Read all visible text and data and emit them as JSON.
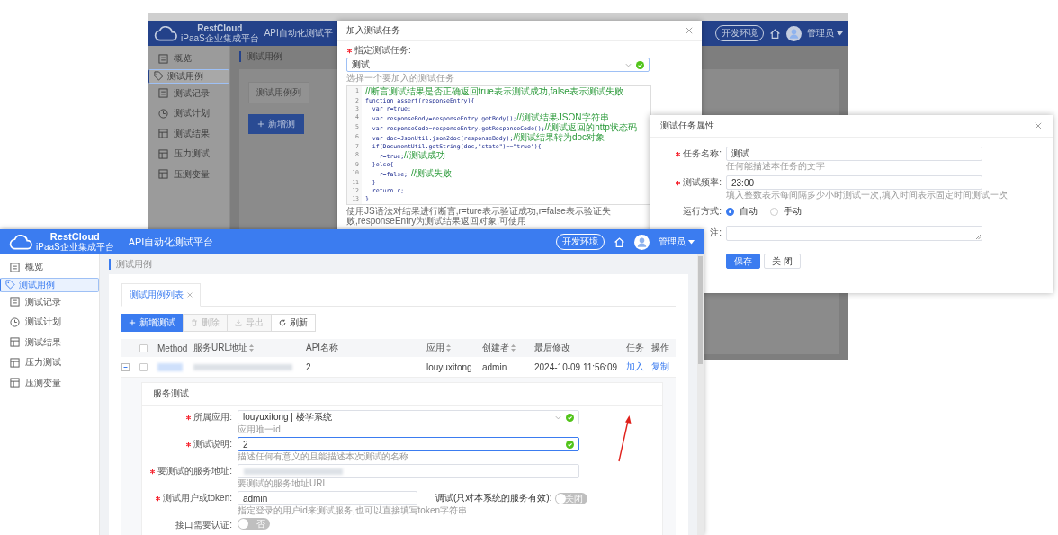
{
  "back_window": {
    "header": {
      "brand": "RestCloud",
      "brand_subtitle": "iPaaS企业集成平台",
      "app_title": "API自动化测试平",
      "env": "开发环境",
      "user": "管理员"
    },
    "sidebar": [
      {
        "label": "概览",
        "selected": false
      },
      {
        "label": "测试用例",
        "selected": true
      },
      {
        "label": "测试记录",
        "selected": false
      },
      {
        "label": "测试计划",
        "selected": false
      },
      {
        "label": "测试结果",
        "selected": false
      },
      {
        "label": "压力测试",
        "selected": false
      },
      {
        "label": "压测变量",
        "selected": false
      }
    ],
    "breadcrumb": "测试用例",
    "tab": "测试用例列",
    "add_button": "新增测",
    "dialog": {
      "title": "加入测试任务",
      "field": {
        "label": "指定测试任务:",
        "required": true,
        "value": "测试",
        "valid": true,
        "hint": "选择一个要加入的测试任务"
      },
      "code_lines": [
        {
          "number": "1",
          "comment": "//断言测试结果是否正确返回true表示测试成功,false表示测试失败"
        },
        {
          "number": "2",
          "code": "function assert(responseEntry){"
        },
        {
          "number": "3",
          "code": "  var r=true;"
        },
        {
          "number": "4",
          "code": "  var responseBody=responseEntry.getBody();",
          "comment": "//测试结果JSON字符串"
        },
        {
          "number": "5",
          "code": "  var responseCode=responseEntry.getResponseCode();",
          "comment": "//测试返回的http状态码"
        },
        {
          "number": "6",
          "code": "  var doc=JsonUtil.json2doc(responseBody);",
          "comment": "//测试结果转为doc对象"
        },
        {
          "number": "7",
          "code": "  if(DocumentUtil.getString(doc,\"state\")==\"true\"){"
        },
        {
          "number": "8",
          "code": "    r=true;",
          "comment": "//测试成功"
        },
        {
          "number": "9",
          "code": "  }else{"
        },
        {
          "number": "10",
          "code": "    r=false; ",
          "comment": "//测试失败"
        },
        {
          "number": "11",
          "code": "  }"
        },
        {
          "number": "12",
          "code": "  return r;"
        },
        {
          "number": "13",
          "code": "}"
        }
      ],
      "note": "使用JS语法对结果进行断言,r=ture表示验证成功,r=false表示验证失败,responseEntry为测试结果返回对象,可使用"
    }
  },
  "task_dialog": {
    "title": "测试任务属性",
    "fields": [
      {
        "kind": "input",
        "label": "任务名称:",
        "required": true,
        "value": "测试",
        "hint": "任何能描述本任务的文字"
      },
      {
        "kind": "input",
        "label": "测试频率:",
        "required": true,
        "value": "23:00",
        "hint": "填入整数表示每间隔多少小时测试一次,填入时间表示固定时间测试一次"
      },
      {
        "kind": "radio",
        "label": "运行方式:",
        "required": false,
        "options": [
          {
            "label": "自动",
            "selected": true
          },
          {
            "label": "手动",
            "selected": false
          }
        ]
      },
      {
        "kind": "textarea",
        "label": "注:",
        "required": false
      }
    ],
    "buttons": [
      {
        "label": "保存",
        "kind": "primary"
      },
      {
        "label": "关 闭",
        "kind": "default"
      }
    ]
  },
  "front_window": {
    "header": {
      "brand": "RestCloud",
      "brand_subtitle": "iPaaS企业集成平台",
      "app_title": "API自动化测试平台",
      "env": "开发环境",
      "user": "管理员"
    },
    "sidebar": [
      {
        "label": "概览",
        "selected": false
      },
      {
        "label": "测试用例",
        "selected": true
      },
      {
        "label": "测试记录",
        "selected": false
      },
      {
        "label": "测试计划",
        "selected": false
      },
      {
        "label": "测试结果",
        "selected": false
      },
      {
        "label": "压力测试",
        "selected": false
      },
      {
        "label": "压测变量",
        "selected": false
      }
    ],
    "breadcrumb": "测试用例",
    "tabs": [
      {
        "label": "测试用例列表",
        "selected": true
      }
    ],
    "toolbar": [
      {
        "label": "新增测试",
        "kind": "primary",
        "disabled": false
      },
      {
        "label": "删除",
        "kind": "default",
        "disabled": true
      },
      {
        "label": "导出",
        "kind": "default",
        "disabled": true
      },
      {
        "label": "刷新",
        "kind": "default",
        "disabled": false
      }
    ],
    "table": {
      "all_checked": false,
      "columns": [
        {
          "label": "Method",
          "sortable": false
        },
        {
          "label": "服务URL地址",
          "sortable": true
        },
        {
          "label": "API名称",
          "sortable": false
        },
        {
          "label": "应用",
          "sortable": true
        },
        {
          "label": "创建者",
          "sortable": true
        },
        {
          "label": "最后修改",
          "sortable": false
        },
        {
          "label": "任务",
          "sortable": false
        },
        {
          "label": "操作",
          "sortable": false
        }
      ],
      "rows": [
        {
          "expanded": true,
          "checked": false,
          "cells": [
            {
              "kind": "blurred-badge"
            },
            {
              "kind": "blurred-text"
            },
            {
              "kind": "text",
              "text": "2"
            },
            {
              "kind": "text",
              "text": "louyuxitong"
            },
            {
              "kind": "text",
              "text": "admin"
            },
            {
              "kind": "text",
              "text": "2024-10-09 11:56:09"
            },
            {
              "kind": "link",
              "text": "加入"
            },
            {
              "kind": "link",
              "text": "复制"
            }
          ]
        }
      ]
    },
    "service_test": {
      "title": "服务测试",
      "fields": [
        {
          "kind": "select",
          "label": "所属应用:",
          "required": true,
          "value": "louyuxitong | 楼学系统",
          "valid": true,
          "focused": false,
          "hint": "应用唯一id"
        },
        {
          "kind": "input",
          "label": "测试说明:",
          "required": true,
          "value": "2",
          "valid": true,
          "focused": true,
          "hint": "描述任何有意义的且能描述本次测试的名称"
        },
        {
          "kind": "blurred",
          "label": "要测试的服务地址:",
          "required": true,
          "hint": "要测试的服务地址URL"
        },
        {
          "kind": "input",
          "label": "测试用户或token:",
          "required": true,
          "value": "admin",
          "valid": false,
          "focused": false,
          "hint": "指定登录的用户id来测试服务,也可以直接填写token字符串",
          "side_switch": {
            "label": "调试(只对本系统的服务有效):",
            "on": false,
            "text": "关闭"
          }
        },
        {
          "kind": "switch",
          "label": "接口需要认证:",
          "required": false,
          "on": false,
          "text": "否"
        }
      ]
    }
  }
}
